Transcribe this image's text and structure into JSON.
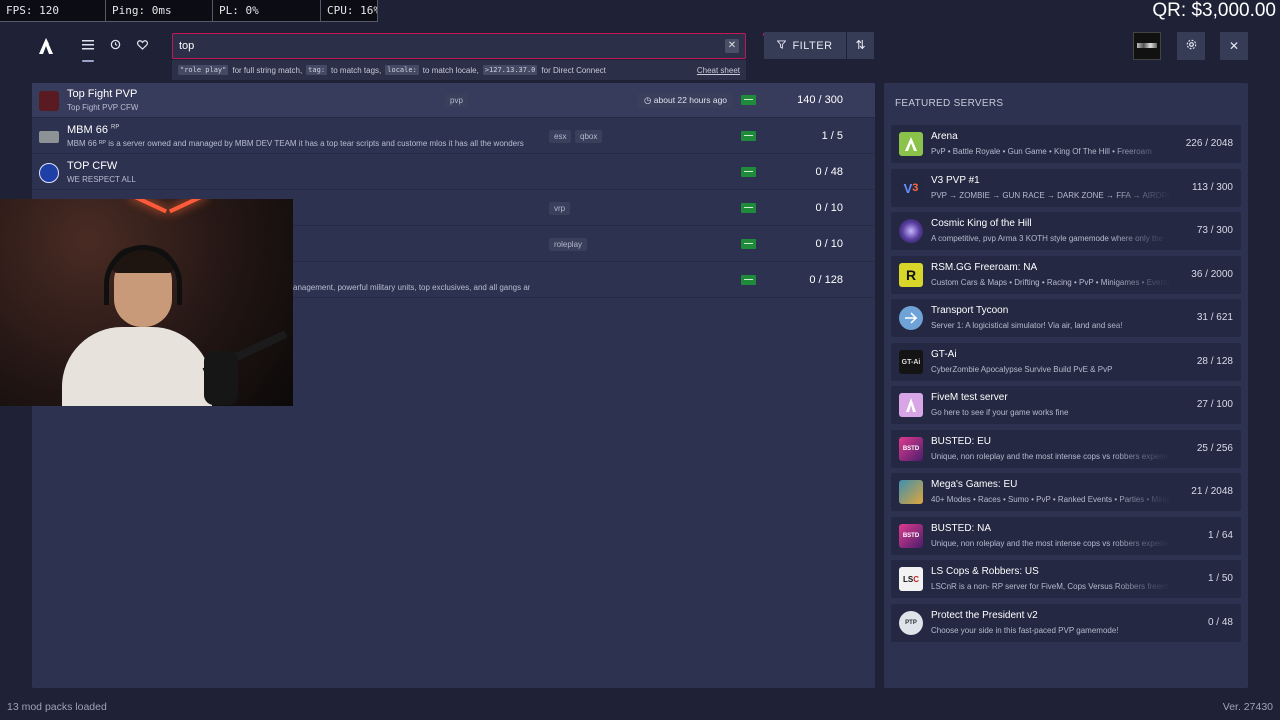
{
  "stats": {
    "fps": "FPS: 120",
    "ping": "Ping: 0ms",
    "pl": "PL: 0%",
    "cpu": "CPU: 16%"
  },
  "qr_balance": "QR: $3,000.00",
  "nav": {
    "logo": "A",
    "menu_icon": "list-icon",
    "history_icon": "history-icon",
    "favorites_icon": "heart-icon"
  },
  "search": {
    "value": "top",
    "placeholder": "",
    "hints": {
      "code1": "\"role play\"",
      "text1": "for full string match,",
      "code2": "tag:",
      "text2": "to match tags,",
      "code3": "locale:",
      "text3": "to match locale,",
      "code4": ">127.13.37.0",
      "text4": "for Direct Connect",
      "cheat": "Cheat sheet"
    }
  },
  "toolbar": {
    "filter_label": "FILTER",
    "sort_icon": "sort-arrows-icon",
    "settings_icon": "gear-icon",
    "close_icon": "close-icon"
  },
  "servers": [
    {
      "name": "Top Fight PVP",
      "sup": "",
      "desc": "Top Fight PVP CFW",
      "tags": [
        "pvp"
      ],
      "ago": "about 22 hours ago",
      "count": "140 / 300"
    },
    {
      "name": "MBM 66",
      "sup": "RP",
      "desc": "MBM 66 ᴿᴾ is a server owned and managed by MBM DEV TEAM it has a top tear scripts and custome mlos it has all the wonders",
      "tags": [
        "esx",
        "qbox"
      ],
      "ago": "",
      "count": "1 / 5"
    },
    {
      "name": "TOP CFW",
      "sup": "",
      "desc": "WE RESPECT ALL",
      "tags": [],
      "ago": "",
      "count": "0 / 48"
    },
    {
      "name": "",
      "sup": "",
      "desc": "",
      "tags": [
        "vrp"
      ],
      "ago": "",
      "count": "0 / 10"
    },
    {
      "name": "",
      "sup": "",
      "desc": "",
      "tags": [
        "roleplay"
      ],
      "ago": "",
      "count": "0 / 10"
    },
    {
      "name": "",
      "sup": "",
      "desc": "anagement, powerful military units, top exclusives, and all gangs ar",
      "tags": [],
      "ago": "",
      "count": "0 / 128"
    }
  ],
  "featured": {
    "title": "FEATURED SERVERS",
    "items": [
      {
        "name": "Arena",
        "desc": "PvP • Battle Royale • Gun Game • King Of The Hill • Freeroam",
        "count": "226 / 2048",
        "icon": "arena-logo-icon",
        "color": "#8bc34a"
      },
      {
        "name": "V3 PVP #1",
        "desc": "PVP → ZOMBIE → GUN RACE → DARK ZONE → FFA → AIRDROP",
        "count": "113 / 300",
        "icon": "v3-logo-icon",
        "color": "#222842"
      },
      {
        "name": "Cosmic King of the Hill",
        "desc": "A competitive, pvp Arma 3 KOTH style gamemode where only the",
        "count": "73 / 300",
        "icon": "cosmic-logo-icon",
        "color": "#3b2a6e"
      },
      {
        "name": "RSM.GG Freeroam: NA",
        "desc": "Custom Cars & Maps • Drifting • Racing • PvP • Minigames • Events",
        "count": "36 / 2000",
        "icon": "rsm-logo-icon",
        "color": "#d9d62a"
      },
      {
        "name": "Transport Tycoon",
        "desc": "Server 1: A logicistical simulator! Via air, land and sea!",
        "count": "31 / 621",
        "icon": "transport-logo-icon",
        "color": "#6fa3d8"
      },
      {
        "name": "GT-Ai",
        "desc": "CyberZombie Apocalypse Survive Build PvE & PvP",
        "count": "28 / 128",
        "icon": "gtai-logo-icon",
        "color": "#141414"
      },
      {
        "name": "FiveM test server",
        "desc": "Go here to see if your game works fine",
        "count": "27 / 100",
        "icon": "fivem-logo-icon",
        "color": "#d8a6e6"
      },
      {
        "name": "BUSTED: EU",
        "desc": "Unique, non roleplay and the most intense cops vs robbers experience",
        "count": "25 / 256",
        "icon": "busted-logo-icon",
        "color": "#a02a7a"
      },
      {
        "name": "Mega's Games: EU",
        "desc": "40+ Modes • Races • Sumo • PvP • Ranked Events • Parties • Minigames",
        "count": "21 / 2048",
        "icon": "megas-logo-icon",
        "color": "#3e8fb0"
      },
      {
        "name": "BUSTED: NA",
        "desc": "Unique, non roleplay and the most intense cops vs robbers experience",
        "count": "1 / 64",
        "icon": "busted-logo-icon",
        "color": "#a02a7a"
      },
      {
        "name": "LS Cops & Robbers: US",
        "desc": "LSCnR is a non- RP server for FiveM, Cops Versus Robbers freeroam",
        "count": "1 / 50",
        "icon": "lscnr-logo-icon",
        "color": "#f2f2f2"
      },
      {
        "name": "Protect the President v2",
        "desc": "Choose your side in this fast-paced PVP gamemode!",
        "count": "0 / 48",
        "icon": "ptp-logo-icon",
        "color": "#dfe3ea"
      }
    ]
  },
  "footer": {
    "left": "13 mod packs loaded",
    "right": "Ver. 27430"
  }
}
